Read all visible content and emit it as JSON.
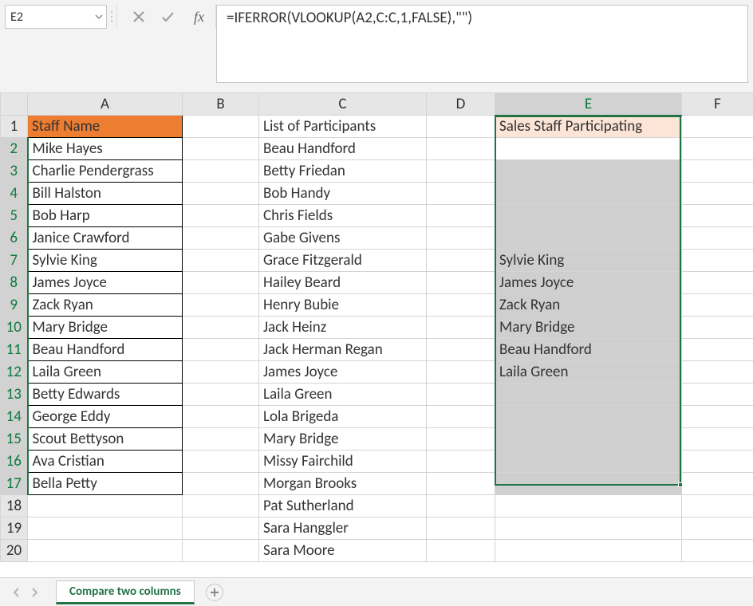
{
  "formula_bar": {
    "name_box": "E2",
    "formula": "=IFERROR(VLOOKUP(A2,C:C,1,FALSE),\"\")",
    "fx_label": "fx"
  },
  "columns": [
    "A",
    "B",
    "C",
    "D",
    "E",
    "F"
  ],
  "rows": [
    "1",
    "2",
    "3",
    "4",
    "5",
    "6",
    "7",
    "8",
    "9",
    "10",
    "11",
    "12",
    "13",
    "14",
    "15",
    "16",
    "17",
    "18",
    "19",
    "20"
  ],
  "headers": {
    "A1": "Staff Name",
    "C1": "List of Participants",
    "E1": "Sales Staff Participating"
  },
  "colA": {
    "r2": "Mike Hayes",
    "r3": "Charlie Pendergrass",
    "r4": "Bill Halston",
    "r5": "Bob Harp",
    "r6": "Janice Crawford",
    "r7": "Sylvie King",
    "r8": "James Joyce",
    "r9": "Zack Ryan",
    "r10": "Mary Bridge",
    "r11": "Beau Handford",
    "r12": "Laila Green",
    "r13": "Betty Edwards",
    "r14": "George Eddy",
    "r15": "Scout Bettyson",
    "r16": "Ava Cristian",
    "r17": "Bella Petty"
  },
  "colC": {
    "r2": "Beau Handford",
    "r3": "Betty Friedan",
    "r4": "Bob Handy",
    "r5": "Chris Fields",
    "r6": "Gabe Givens",
    "r7": "Grace Fitzgerald",
    "r8": "Hailey Beard",
    "r9": "Henry Bubie",
    "r10": "Jack Heinz",
    "r11": "Jack Herman Regan",
    "r12": "James Joyce",
    "r13": "Laila Green",
    "r14": "Lola Brigeda",
    "r15": "Mary Bridge",
    "r16": "Missy Fairchild",
    "r17": "Morgan Brooks",
    "r18": "Pat Sutherland",
    "r19": "Sara Hanggler",
    "r20": "Sara Moore"
  },
  "colE": {
    "r7": "Sylvie King",
    "r8": "James Joyce",
    "r9": "Zack Ryan",
    "r10": "Mary Bridge",
    "r11": "Beau Handford",
    "r12": "Laila Green"
  },
  "sheet_tab": "Compare two columns"
}
